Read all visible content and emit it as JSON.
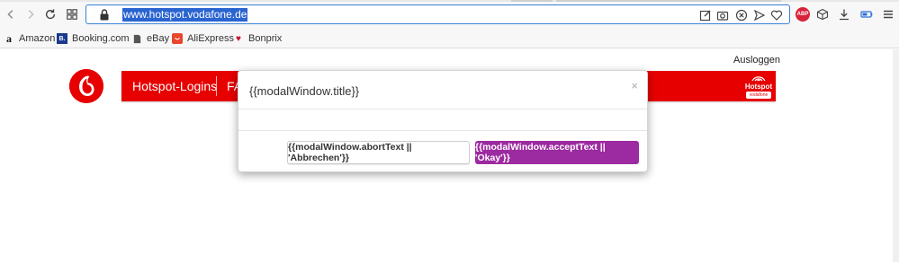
{
  "browser": {
    "url": "www.hotspot.vodafone.de",
    "abp_label": "ABP"
  },
  "bookmarks": [
    {
      "label": "Amazon",
      "icon": "amazon-icon"
    },
    {
      "label": "Booking.com",
      "icon": "booking-icon",
      "glyph": "B."
    },
    {
      "label": "eBay",
      "icon": "page-icon"
    },
    {
      "label": "AliExpress",
      "icon": "aliexpress-icon"
    },
    {
      "label": "Bonprix",
      "icon": "bonprix-icon"
    }
  ],
  "page": {
    "logout_label": "Ausloggen",
    "nav_items": [
      "Hotspot-Logins",
      "FA"
    ],
    "badge_text": "Hotspot",
    "badge_sub": "vodafone",
    "brand_color": "#e60000"
  },
  "modal": {
    "title": "{{modalWindow.title}}",
    "close_glyph": "×",
    "abort_label": "{{modalWindow.abortText || 'Abbrechen'}}",
    "accept_label": "{{modalWindow.acceptText || 'Okay'}}",
    "accept_color": "#9c2aa0"
  }
}
